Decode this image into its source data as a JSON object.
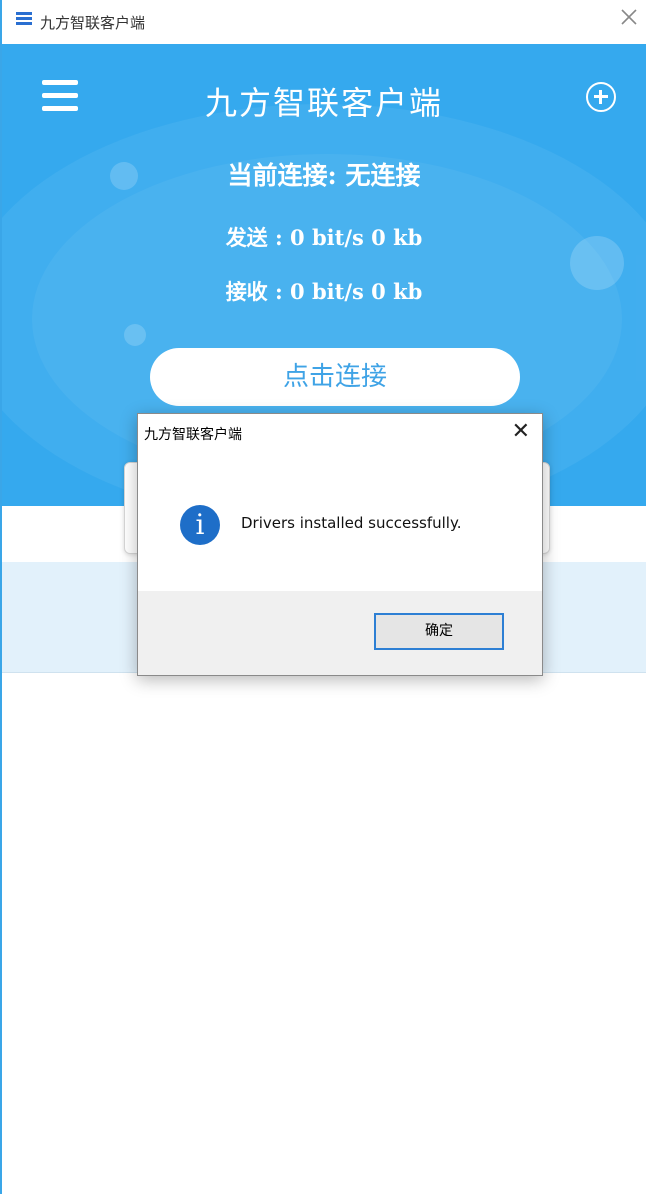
{
  "window": {
    "title": "九方智联客户端",
    "icon": "app-grid-icon",
    "close_icon": "close-icon"
  },
  "header": {
    "menu_icon": "hamburger-menu-icon",
    "title": "九方智联客户端",
    "add_icon": "plus-circle-icon"
  },
  "status": {
    "connection": "当前连接: 无连接",
    "send": "发送 : 0 bit/s 0 kb",
    "receive": "接收 : 0 bit/s 0 kb"
  },
  "connect_button": "点击连接",
  "dialog": {
    "title": "九方智联客户端",
    "close_symbol": "✕",
    "icon": "info-icon",
    "icon_glyph": "i",
    "message": "Drivers installed successfully.",
    "ok_label": "确定"
  },
  "colors": {
    "hero_bg": "#35a9ee",
    "accent": "#2d7fd4",
    "band_bg": "#e2f1fb"
  }
}
